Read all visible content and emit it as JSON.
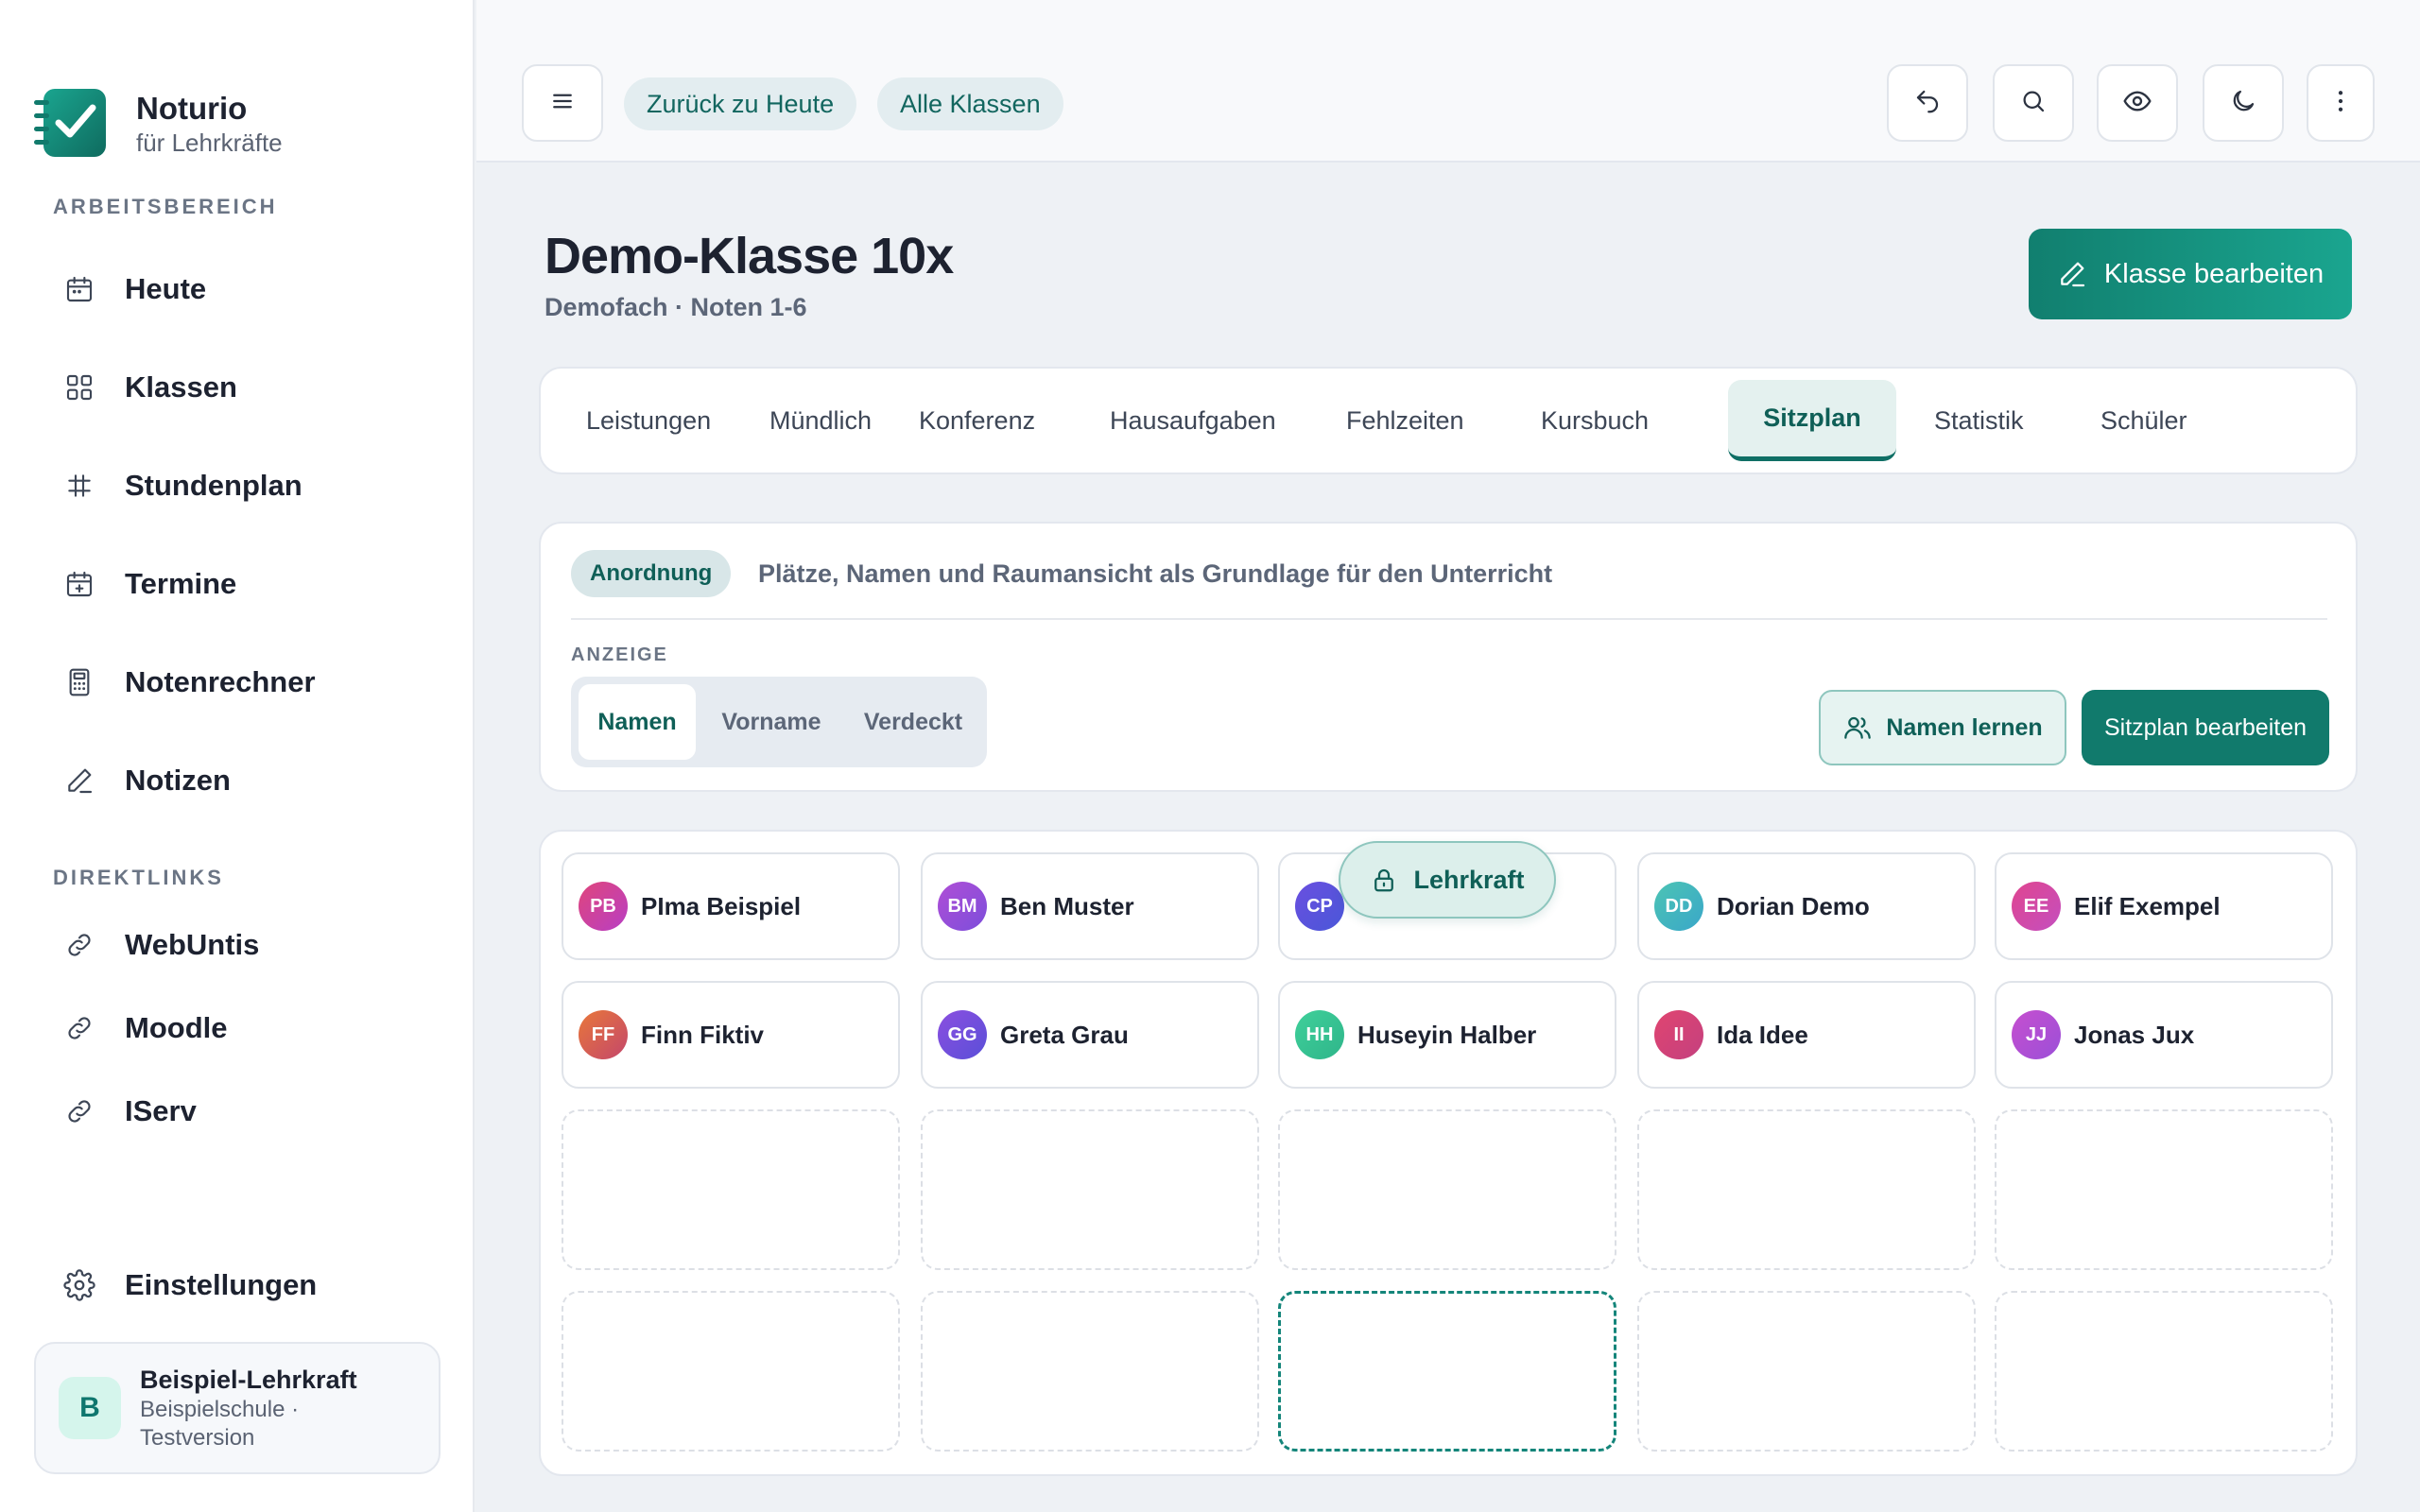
{
  "brand": {
    "name": "Noturio",
    "subtitle": "für Lehrkräfte"
  },
  "sidebar": {
    "workspace_label": "ARBEITSBEREICH",
    "items": [
      {
        "label": "Heute",
        "icon": "calendar-icon"
      },
      {
        "label": "Klassen",
        "icon": "grid-icon"
      },
      {
        "label": "Stundenplan",
        "icon": "timetable-icon"
      },
      {
        "label": "Termine",
        "icon": "calendar-plus-icon"
      },
      {
        "label": "Notenrechner",
        "icon": "calculator-icon"
      },
      {
        "label": "Notizen",
        "icon": "pencil-icon"
      }
    ],
    "links_label": "DIREKTLINKS",
    "links": [
      {
        "label": "WebUntis",
        "icon": "link-icon"
      },
      {
        "label": "Moodle",
        "icon": "link-icon"
      },
      {
        "label": "IServ",
        "icon": "link-icon"
      }
    ],
    "settings_label": "Einstellungen",
    "user": {
      "initial": "B",
      "name": "Beispiel-Lehrkraft",
      "line1": "Beispielschule ·",
      "line2": "Testversion"
    }
  },
  "topbar": {
    "breadcrumbs": [
      "Zurück zu Heute",
      "Alle Klassen"
    ],
    "actions": [
      "undo-icon",
      "search-icon",
      "eye-icon",
      "moon-icon",
      "more-vertical-icon"
    ]
  },
  "page": {
    "title": "Demo-Klasse 10x",
    "subtitle": "Demofach · Noten 1-6",
    "edit_class_label": "Klasse bearbeiten"
  },
  "tabs": [
    "Leistungen",
    "Mündlich",
    "Konferenz",
    "Hausaufgaben",
    "Fehlzeiten",
    "Kursbuch",
    "Sitzplan",
    "Statistik",
    "Schüler"
  ],
  "active_tab": "Sitzplan",
  "panel": {
    "badge": "Anordnung",
    "description": "Plätze, Namen und Raumansicht als Grundlage für den Unterricht",
    "display_label": "ANZEIGE",
    "display_options": [
      "Namen",
      "Vorname",
      "Verdeckt"
    ],
    "display_selected": "Namen",
    "learn_names_label": "Namen lernen",
    "edit_seating_label": "Sitzplan bearbeiten"
  },
  "seating": {
    "teacher_label": "Lehrkraft",
    "students": [
      {
        "initials": "PB",
        "name": "PIma Beispiel",
        "color_from": "#e0457b",
        "color_to": "#b83fc4"
      },
      {
        "initials": "BM",
        "name": "Ben Muster",
        "color_from": "#b04fd6",
        "color_to": "#7c4ddb"
      },
      {
        "initials": "CP",
        "name": "",
        "color_from": "#6a4fe0",
        "color_to": "#4a57d8"
      },
      {
        "initials": "DD",
        "name": "Dorian Demo",
        "color_from": "#4cc4b4",
        "color_to": "#3aa7c9"
      },
      {
        "initials": "EE",
        "name": "Elif Exempel",
        "color_from": "#e0458f",
        "color_to": "#c44fbf"
      },
      {
        "initials": "FF",
        "name": "Finn Fiktiv",
        "color_from": "#e8773a",
        "color_to": "#c4476b"
      },
      {
        "initials": "GG",
        "name": "Greta Grau",
        "color_from": "#8b4fe0",
        "color_to": "#5a4fd8"
      },
      {
        "initials": "HH",
        "name": "Huseyin Halber",
        "color_from": "#3fd09a",
        "color_to": "#2fb58a"
      },
      {
        "initials": "II",
        "name": "Ida Idee",
        "color_from": "#e04570",
        "color_to": "#c4407f"
      },
      {
        "initials": "JJ",
        "name": "Jonas Jux",
        "color_from": "#c64fcf",
        "color_to": "#9b4fd8"
      }
    ]
  },
  "colors": {
    "accent": "#117a6c",
    "accent_light": "#e4f1ef",
    "background": "#eef1f5"
  }
}
